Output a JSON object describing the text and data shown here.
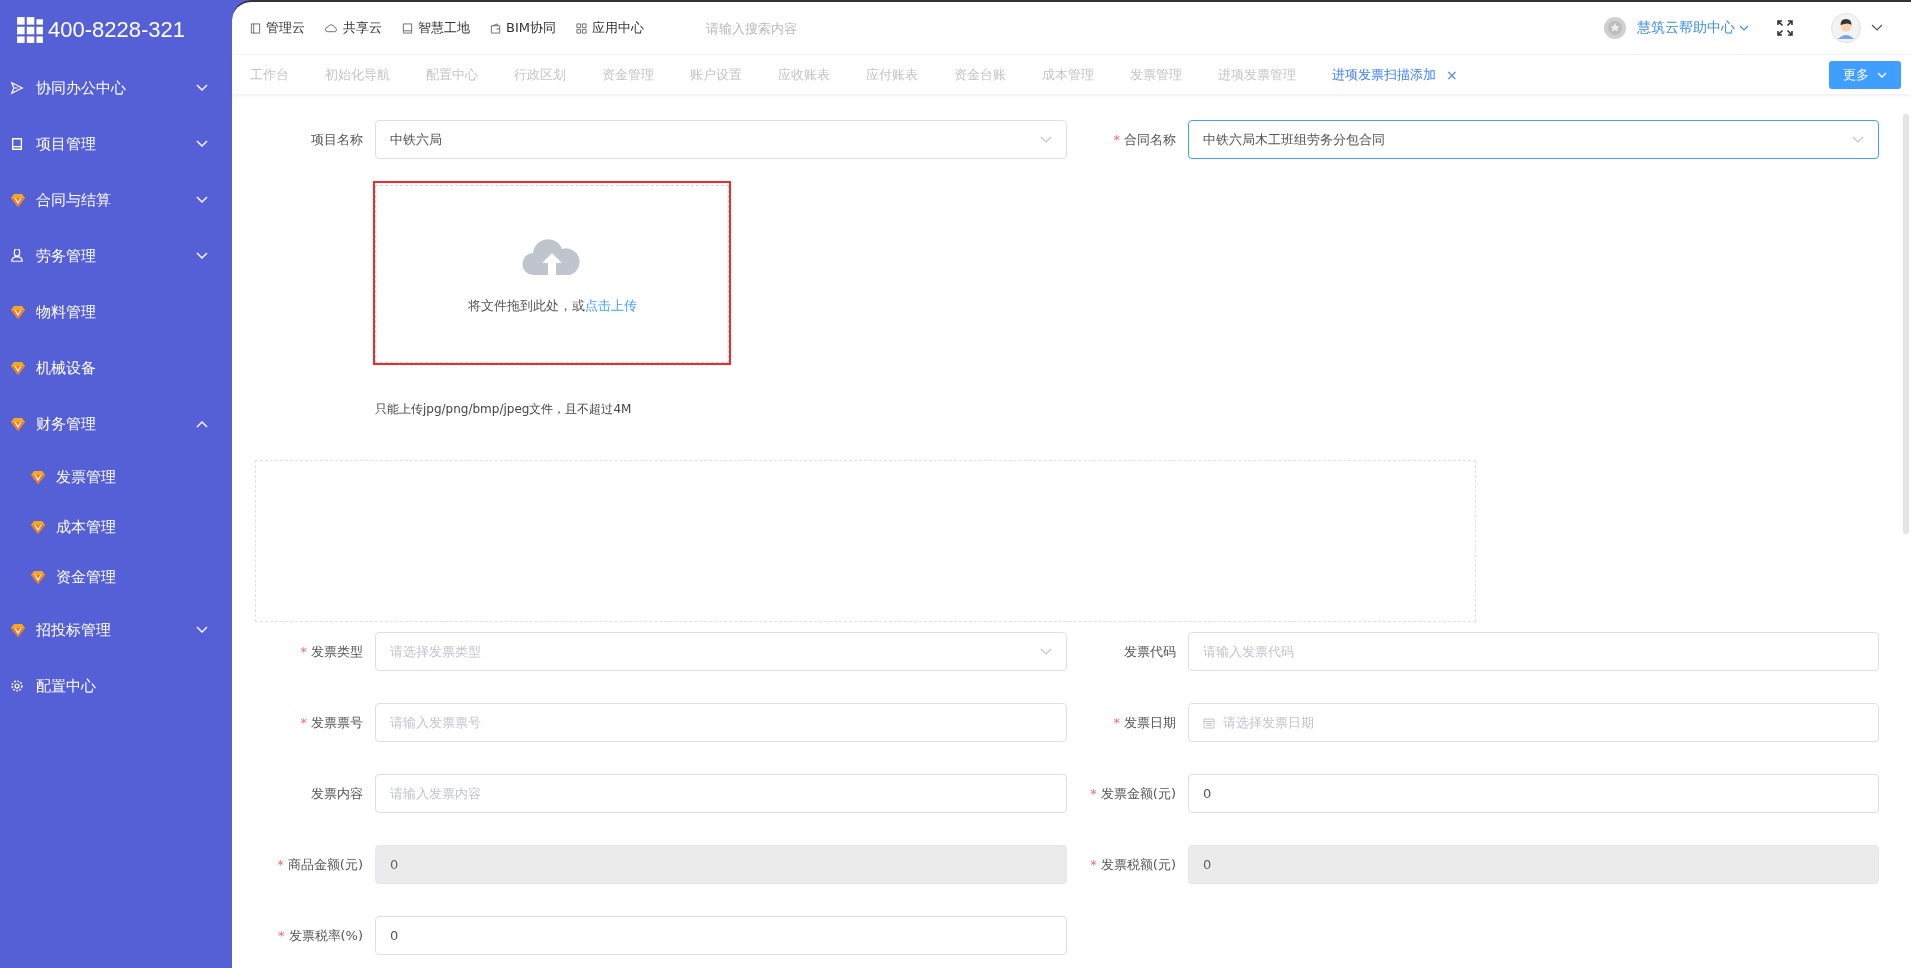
{
  "brand": {
    "phone": "400-8228-321"
  },
  "sidebar": {
    "items": [
      {
        "label": "协同办公中心",
        "kind": "send",
        "expanded": false
      },
      {
        "label": "项目管理",
        "kind": "book",
        "expanded": false
      },
      {
        "label": "合同与结算",
        "kind": "gem",
        "expanded": false
      },
      {
        "label": "劳务管理",
        "kind": "user",
        "expanded": false
      },
      {
        "label": "物料管理",
        "kind": "gem"
      },
      {
        "label": "机械设备",
        "kind": "gem"
      },
      {
        "label": "财务管理",
        "kind": "gem",
        "expanded": true,
        "children": [
          {
            "label": "发票管理"
          },
          {
            "label": "成本管理"
          },
          {
            "label": "资金管理"
          }
        ]
      },
      {
        "label": "招投标管理",
        "kind": "gem",
        "expanded": false
      },
      {
        "label": "配置中心",
        "kind": "gear"
      }
    ]
  },
  "top_nav": [
    {
      "label": "管理云",
      "kind": "panel"
    },
    {
      "label": "共享云",
      "kind": "cloud"
    },
    {
      "label": "智慧工地",
      "kind": "book"
    },
    {
      "label": "BIM协同",
      "kind": "wallet"
    },
    {
      "label": "应用中心",
      "kind": "grid"
    }
  ],
  "search": {
    "placeholder": "请输入搜索内容"
  },
  "help": {
    "label": "慧筑云帮助中心"
  },
  "tabs": [
    {
      "label": "工作台",
      "selected": false
    },
    {
      "label": "初始化导航",
      "selected": false
    },
    {
      "label": "配置中心",
      "selected": false
    },
    {
      "label": "行政区划",
      "selected": false
    },
    {
      "label": "资金管理",
      "selected": false
    },
    {
      "label": "账户设置",
      "selected": false
    },
    {
      "label": "应收账表",
      "selected": false
    },
    {
      "label": "应付账表",
      "selected": false
    },
    {
      "label": "资金台账",
      "selected": false
    },
    {
      "label": "成本管理",
      "selected": false
    },
    {
      "label": "发票管理",
      "selected": false
    },
    {
      "label": "进项发票管理",
      "selected": false
    },
    {
      "label": "进项发票扫描添加",
      "selected": true,
      "close": "×"
    }
  ],
  "more_button": "更多",
  "head_fields": [
    {
      "label": "项目名称",
      "kind": "select",
      "value": "中铁六局",
      "focused": false
    },
    {
      "label": "合同名称",
      "kind": "select",
      "mark": "*",
      "value": "中铁六局木工班组劳务分包合同",
      "focused": true
    }
  ],
  "upload": {
    "text": "将文件拖到此处，或",
    "link": "点击上传",
    "highlighted": true,
    "hint": "只能上传jpg/png/bmp/jpeg文件，且不超过4M"
  },
  "fields": [
    {
      "label": "发票类型",
      "kind": "select",
      "mark": "*",
      "placeholder": "请选择发票类型",
      "disabled": false
    },
    {
      "label": "发票代码",
      "kind": "input",
      "placeholder": "请输入发票代码",
      "disabled": false
    },
    {
      "label": "发票票号",
      "kind": "input",
      "mark": "*",
      "placeholder": "请输入发票票号",
      "disabled": false
    },
    {
      "label": "发票日期",
      "kind": "date",
      "mark": "*",
      "placeholder": "请选择发票日期",
      "disabled": false
    },
    {
      "label": "发票内容",
      "kind": "input",
      "placeholder": "请输入发票内容",
      "disabled": false
    },
    {
      "label": "发票金额(元)",
      "kind": "input",
      "mark": "*",
      "value": "0",
      "disabled": false
    },
    {
      "label": "商品金额(元)",
      "kind": "input",
      "mark": "*",
      "value": "0",
      "disabled": true
    },
    {
      "label": "发票税额(元)",
      "kind": "input",
      "mark": "*",
      "value": "0",
      "disabled": true
    },
    {
      "label": "发票税率(%)",
      "kind": "input",
      "mark": "*",
      "value": "0",
      "disabled": false
    }
  ]
}
